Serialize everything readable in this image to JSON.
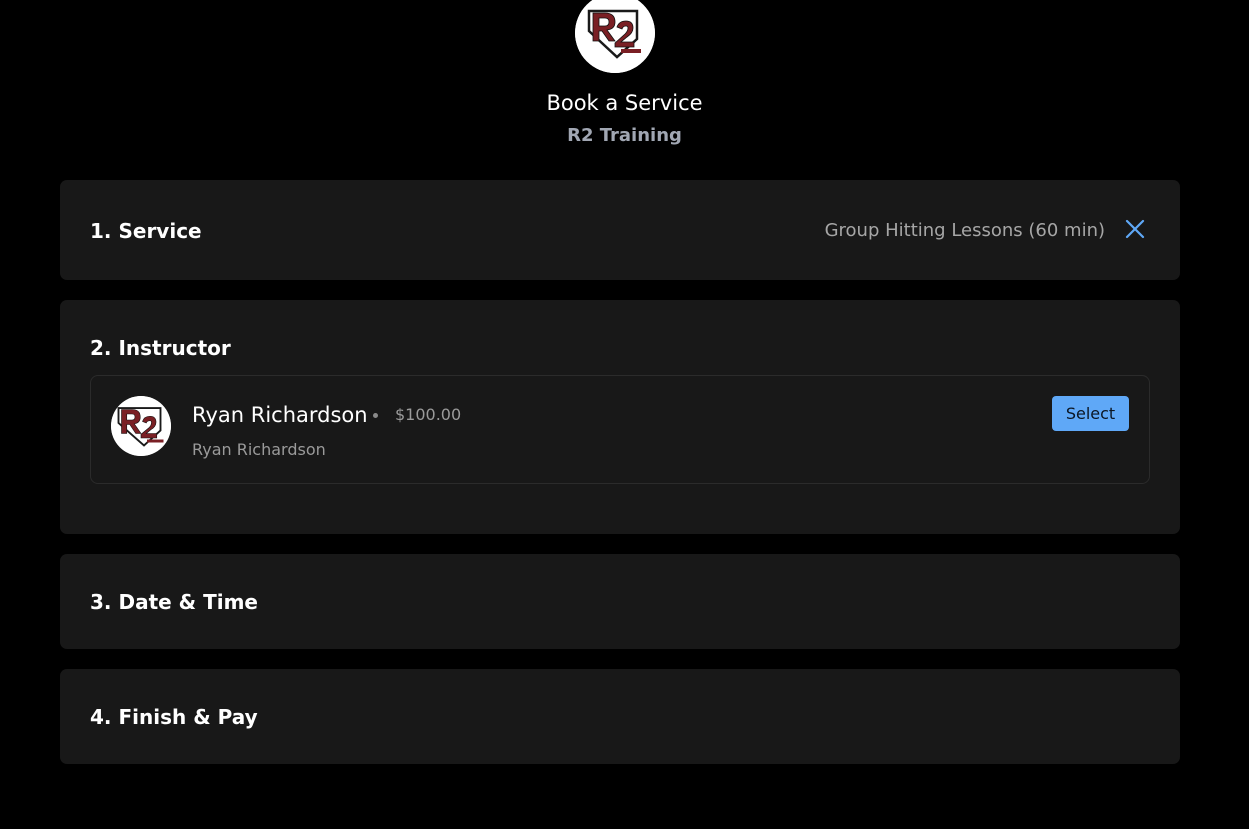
{
  "header": {
    "title": "Book a Service",
    "business_name": "R2 Training",
    "logo_icon": "r2-training-logo"
  },
  "steps": {
    "service": {
      "title": "1. Service",
      "selected_value": "Group Hitting Lessons (60 min)",
      "clear_icon": "close-icon"
    },
    "instructor": {
      "title": "2. Instructor",
      "options": [
        {
          "name": "Ryan Richardson",
          "price": "$100.00",
          "subtitle": "Ryan Richardson",
          "select_label": "Select",
          "avatar_icon": "r2-training-logo"
        }
      ]
    },
    "datetime": {
      "title": "3. Date & Time"
    },
    "finish": {
      "title": "4. Finish & Pay"
    }
  },
  "colors": {
    "background": "#000000",
    "card": "#181818",
    "accent": "#5fa8f7",
    "muted_text": "#9a9a9a",
    "logo_red": "#7a1f24"
  }
}
